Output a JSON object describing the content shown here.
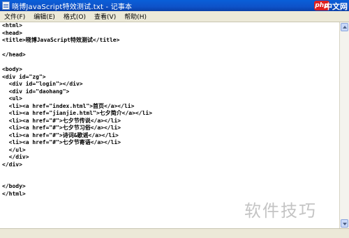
{
  "window": {
    "title": "晓博JavaScript特效测试.txt - 记事本"
  },
  "menu": [
    "文件(F)",
    "编辑(E)",
    "格式(O)",
    "查看(V)",
    "帮助(H)"
  ],
  "logo": {
    "badge": "php",
    "text": "中文网"
  },
  "editor": {
    "lines": [
      "<html>",
      "<head>",
      "<title>晓博JavaScript特效测试</title>",
      "",
      "</head>",
      "",
      "<body>",
      "<div id=\"zg\">",
      "  <div id=\"login\"></div>",
      "  <div id=\"daohang\">",
      "  <ul>",
      "  <li><a href=\"index.html\">首页</a></li>",
      "  <li><a href=\"jianjie.html\">七夕简介</a></li>",
      "  <li><a href=\"#\">七夕节传说</a></li>",
      "  <li><a href=\"#\">七夕节习俗</a></li>",
      "  <li><a href=\"#\">诗词&歌谣</a></li>",
      "  <li><a href=\"#\">七夕节寄语</a></li>",
      "  </ul>",
      "  </div>",
      "</div>",
      "",
      "",
      "</body>",
      "</html>"
    ]
  },
  "watermark": {
    "text": "软件技巧"
  }
}
